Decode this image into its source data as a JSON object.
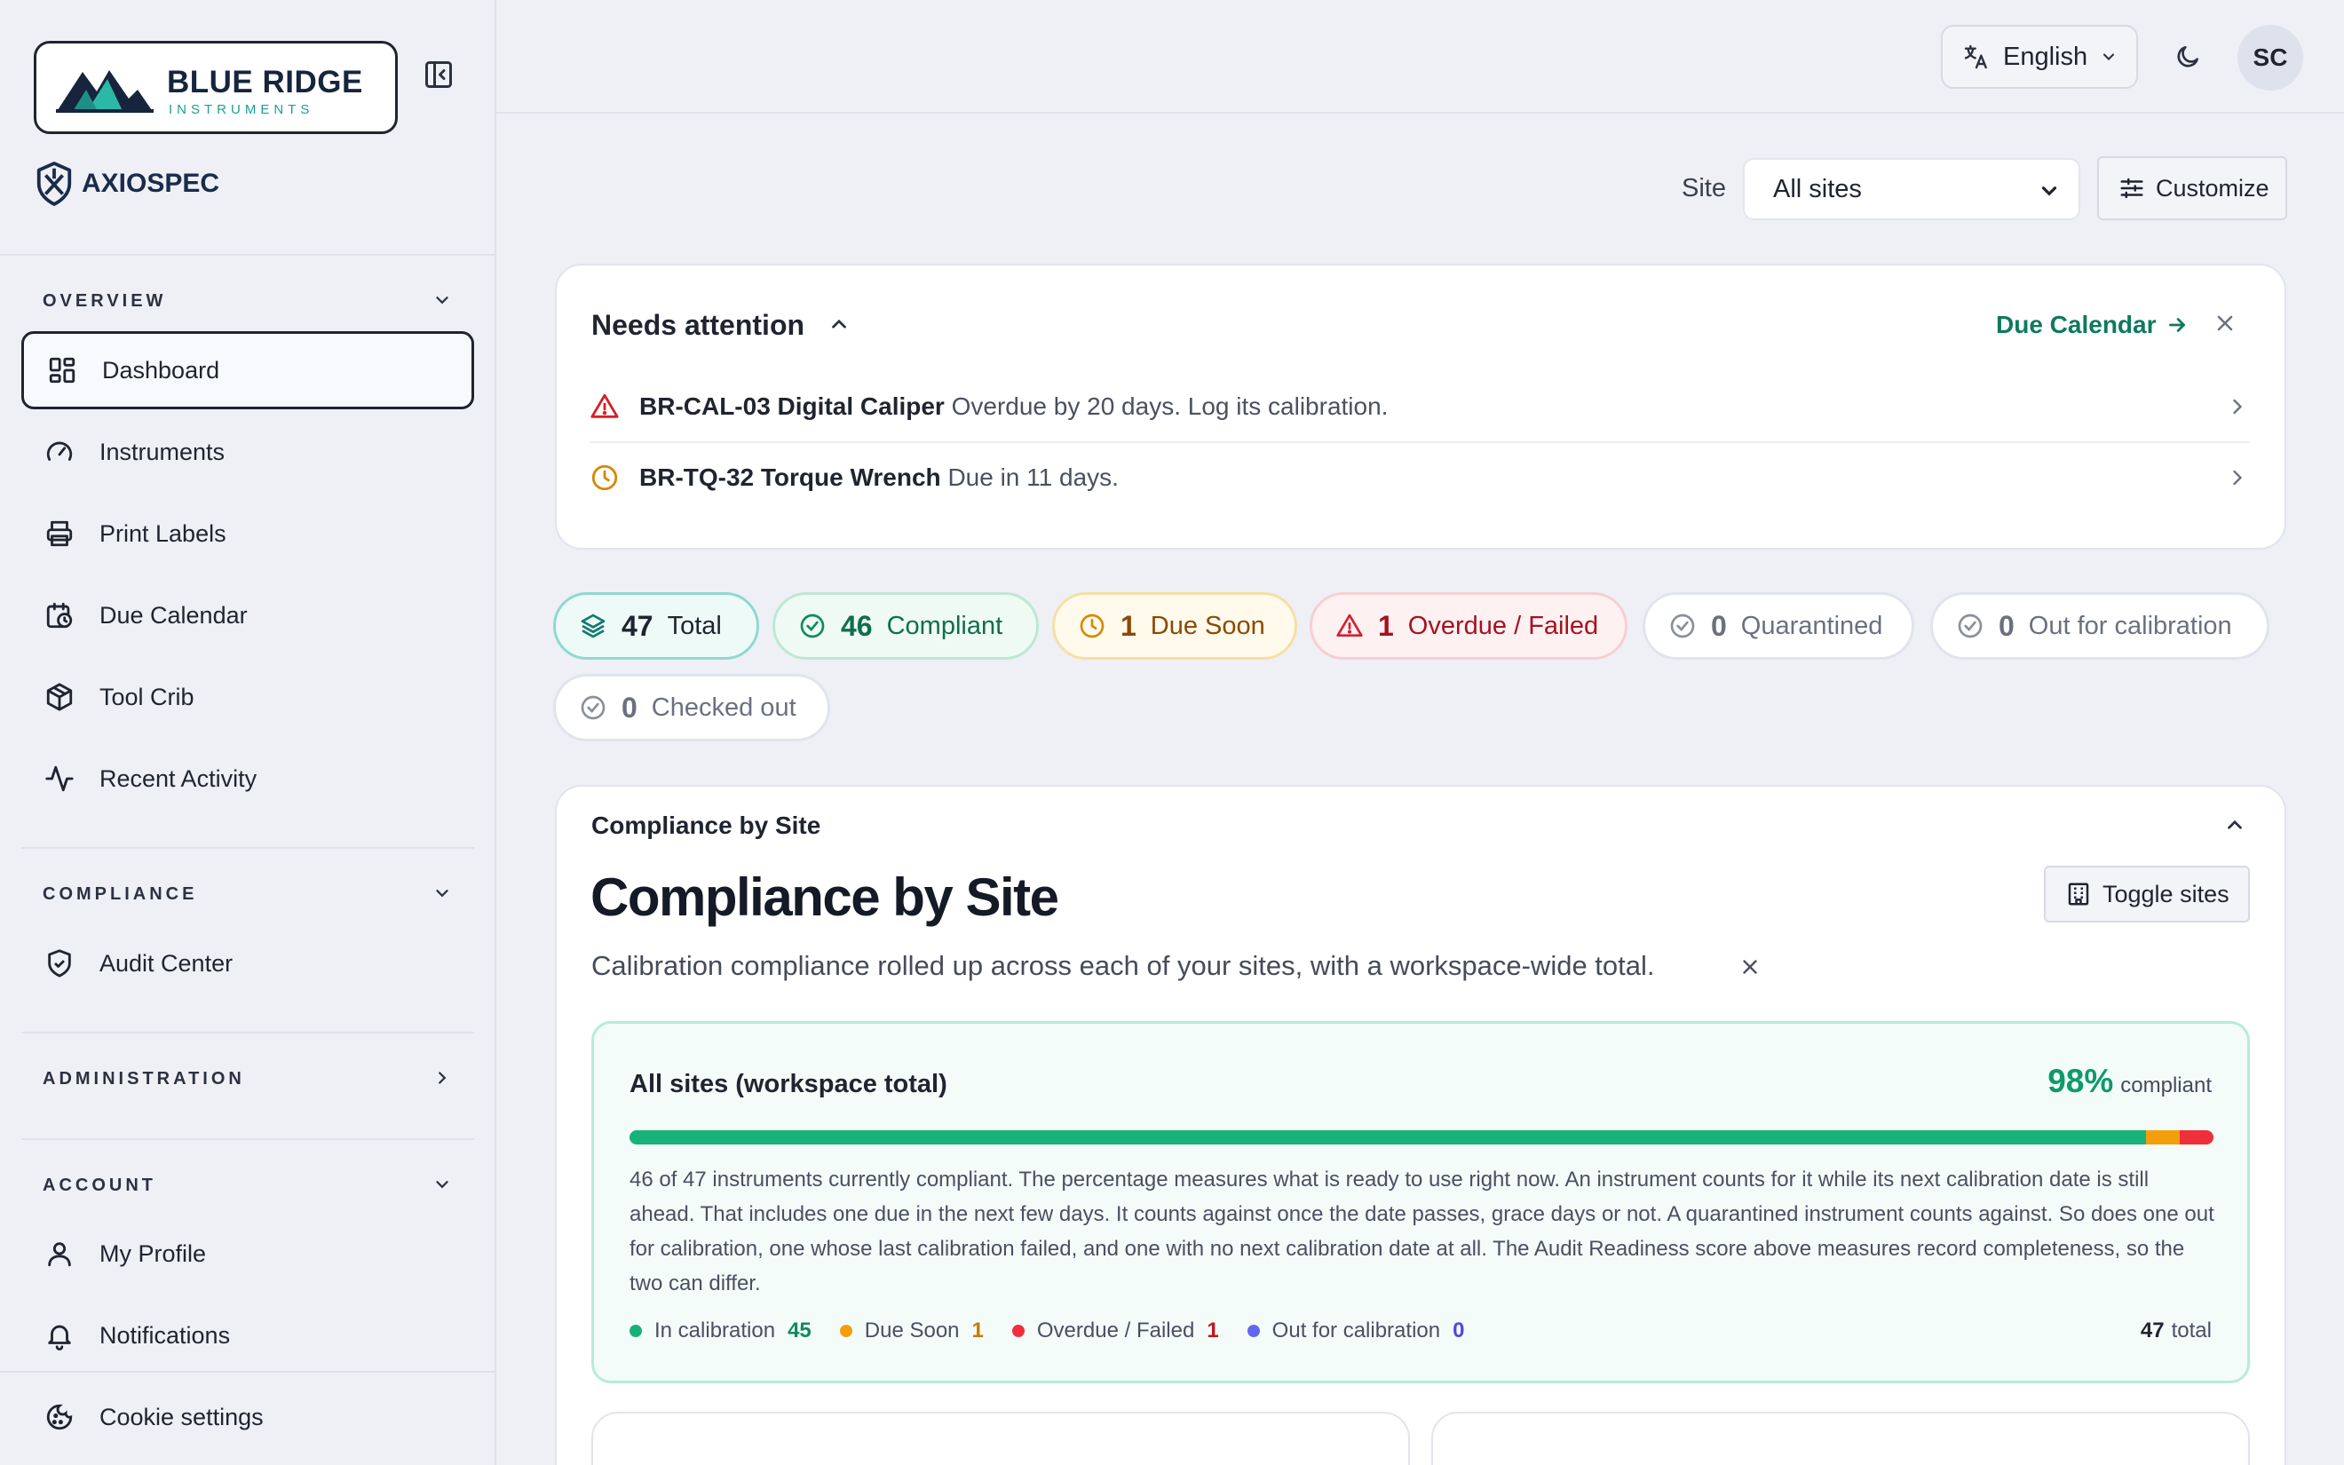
{
  "brand": {
    "logo_title": "BLUE RIDGE",
    "logo_subtitle": "INSTRUMENTS",
    "product": "AXIOSPEC"
  },
  "sidebar": {
    "overview_label": "OVERVIEW",
    "compliance_label": "COMPLIANCE",
    "administration_label": "ADMINISTRATION",
    "account_label": "ACCOUNT",
    "items": {
      "dashboard": "Dashboard",
      "instruments": "Instruments",
      "print_labels": "Print Labels",
      "due_calendar": "Due Calendar",
      "tool_crib": "Tool Crib",
      "recent_activity": "Recent Activity",
      "audit_center": "Audit Center",
      "my_profile": "My Profile",
      "notifications": "Notifications",
      "cookie_settings": "Cookie settings"
    }
  },
  "topbar": {
    "language": "English",
    "avatar_initials": "SC"
  },
  "filters": {
    "site_label": "Site",
    "site_value": "All sites",
    "customize_label": "Customize"
  },
  "attention": {
    "title": "Needs attention",
    "due_calendar_link": "Due Calendar",
    "items": [
      {
        "name": "BR-CAL-03 Digital Caliper",
        "detail": "Overdue by 20 days. Log its calibration.",
        "status": "overdue"
      },
      {
        "name": "BR-TQ-32 Torque Wrench",
        "detail": "Due in 11 days.",
        "status": "due-soon"
      }
    ]
  },
  "stats": [
    {
      "count": "47",
      "label": "Total"
    },
    {
      "count": "46",
      "label": "Compliant"
    },
    {
      "count": "1",
      "label": "Due Soon"
    },
    {
      "count": "1",
      "label": "Overdue / Failed"
    },
    {
      "count": "0",
      "label": "Quarantined"
    },
    {
      "count": "0",
      "label": "Out for calibration"
    },
    {
      "count": "0",
      "label": "Checked out"
    }
  ],
  "compliance": {
    "section_label": "Compliance by Site",
    "heading": "Compliance by Site",
    "toggle_label": "Toggle sites",
    "description": "Calibration compliance rolled up across each of your sites, with a workspace-wide total.",
    "all_sites": {
      "title": "All sites (workspace total)",
      "percent": "98%",
      "percent_label": "compliant",
      "text": "46 of 47 instruments currently compliant. The percentage measures what is ready to use right now. An instrument counts for it while its next calibration date is still ahead. That includes one due in the next few days. It counts against once the date passes, grace days or not. A quarantined instrument counts against. So does one out for calibration, one whose last calibration failed, and one with no next calibration date at all. The Audit Readiness score above measures record completeness, so the two can differ.",
      "legend": [
        {
          "label": "In calibration",
          "value": "45",
          "color": "#16b27a"
        },
        {
          "label": "Due Soon",
          "value": "1",
          "color": "#f59e0b"
        },
        {
          "label": "Overdue / Failed",
          "value": "1",
          "color": "#ef2f3a"
        },
        {
          "label": "Out for calibration",
          "value": "0",
          "color": "#6366f1"
        }
      ],
      "total": "47",
      "total_label": "total"
    }
  }
}
